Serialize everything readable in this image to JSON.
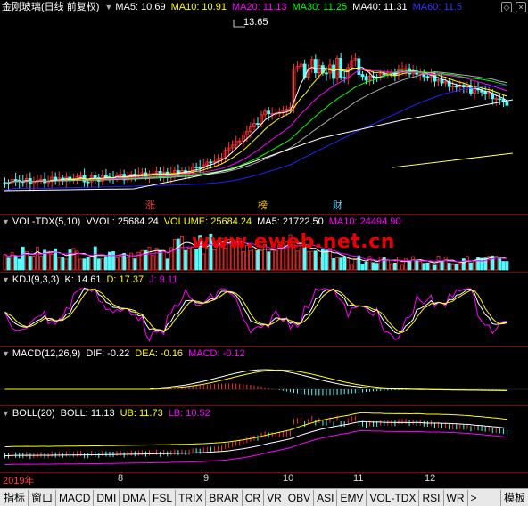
{
  "main": {
    "stock_title": "金刚玻璃(日线 前复权)",
    "ma": [
      {
        "label": "MA5: 10.69",
        "color": "#ffffff"
      },
      {
        "label": "MA10: 10.91",
        "color": "#ffff00"
      },
      {
        "label": "MA20: 11.13",
        "color": "#ff00ff"
      },
      {
        "label": "MA30: 11.25",
        "color": "#00ff00"
      },
      {
        "label": "MA40: 11.31",
        "color": "#ffffff"
      },
      {
        "label": "MA60: 11.5",
        "color": "#0000ff"
      }
    ],
    "high_label": "13.65",
    "tags": [
      "涨",
      "榜",
      "财"
    ]
  },
  "vol": {
    "title": "VOL-TDX(5,10)",
    "vvol": "VVOL: 25684.24",
    "volume": "VOLUME: 25684.24",
    "ma5": "MA5: 21722.50",
    "ma10": "MA10: 24494.90"
  },
  "watermark": "www.eweb.net.cn",
  "kdj": {
    "title": "KDJ(9,3,3)",
    "k": "K: 14.61",
    "d": "D: 17.37",
    "j": "J: 9.11"
  },
  "macd": {
    "title": "MACD(12,26,9)",
    "dif": "DIF: -0.22",
    "dea": "DEA: -0.16",
    "macd": "MACD: -0.12"
  },
  "boll": {
    "title": "BOLL(20)",
    "boll": "BOLL: 11.13",
    "ub": "UB: 11.73",
    "lb": "LB: 10.52"
  },
  "axis": {
    "labels": [
      "2019年",
      "8",
      "9",
      "10",
      "11",
      "12"
    ]
  },
  "tabs": [
    "指标",
    "窗口",
    "MACD",
    "DMI",
    "DMA",
    "FSL",
    "TRIX",
    "BRAR",
    "CR",
    "VR",
    "OBV",
    "ASI",
    "EMV",
    "VOL-TDX",
    "RSI",
    "WR",
    ">"
  ],
  "right_tab": "模板",
  "colors": {
    "up": "#ff3232",
    "down": "#54fcfc",
    "border": "#8b0000"
  }
}
